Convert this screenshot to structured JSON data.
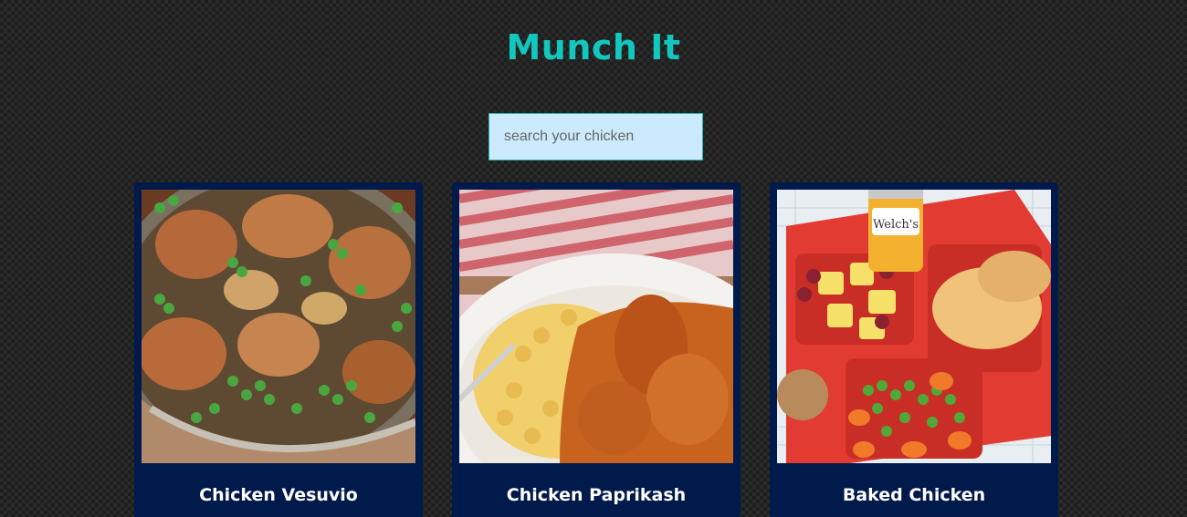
{
  "header": {
    "title": "Munch It"
  },
  "search": {
    "placeholder": "search your chicken",
    "value": ""
  },
  "recipes": [
    {
      "name": "Chicken Vesuvio",
      "image_icon": "chicken-vesuvio-photo"
    },
    {
      "name": "Chicken Paprikash",
      "image_icon": "chicken-paprikash-photo"
    },
    {
      "name": "Baked Chicken",
      "image_icon": "baked-chicken-photo"
    }
  ],
  "colors": {
    "title": "#12c7be",
    "search_bg": "#cbeafe",
    "card_bg": "#001a4b",
    "card_text": "#ffffff"
  }
}
